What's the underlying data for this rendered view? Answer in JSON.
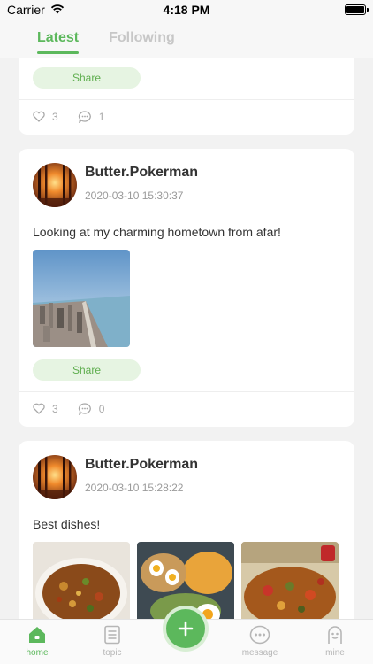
{
  "status_bar": {
    "carrier": "Carrier",
    "time": "4:18 PM"
  },
  "tabs": [
    {
      "label": "Latest",
      "active": true
    },
    {
      "label": "Following",
      "active": false
    }
  ],
  "posts": [
    {
      "share_label": "Share",
      "likes": "3",
      "comments": "1"
    },
    {
      "username": "Butter.Pokerman",
      "timestamp": "2020-03-10 15:30:37",
      "text": "Looking at my charming hometown from afar!",
      "share_label": "Share",
      "likes": "3",
      "comments": "0"
    },
    {
      "username": "Butter.Pokerman",
      "timestamp": "2020-03-10 15:28:22",
      "text": "Best dishes!"
    }
  ],
  "bottom_nav": {
    "items": [
      {
        "label": "home",
        "icon": "home-icon",
        "active": true
      },
      {
        "label": "topic",
        "icon": "topic-icon",
        "active": false
      },
      {
        "label": "message",
        "icon": "message-icon",
        "active": false
      },
      {
        "label": "mine",
        "icon": "mine-icon",
        "active": false
      }
    ],
    "fab_icon": "plus-icon"
  },
  "colors": {
    "accent": "#5cb85c",
    "share_bg": "#e6f4e2",
    "background": "#f2f2f2"
  }
}
